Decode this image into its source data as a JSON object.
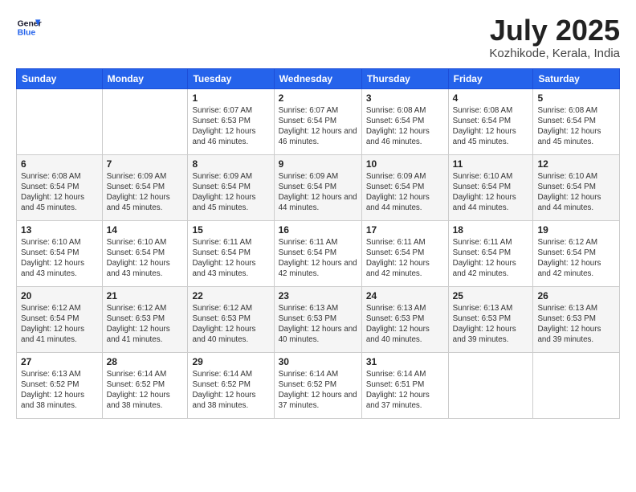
{
  "header": {
    "logo_line1": "General",
    "logo_line2": "Blue",
    "title": "July 2025",
    "subtitle": "Kozhikode, Kerala, India"
  },
  "days_of_week": [
    "Sunday",
    "Monday",
    "Tuesday",
    "Wednesday",
    "Thursday",
    "Friday",
    "Saturday"
  ],
  "weeks": [
    [
      {
        "day": "",
        "info": ""
      },
      {
        "day": "",
        "info": ""
      },
      {
        "day": "1",
        "info": "Sunrise: 6:07 AM\nSunset: 6:53 PM\nDaylight: 12 hours and 46 minutes."
      },
      {
        "day": "2",
        "info": "Sunrise: 6:07 AM\nSunset: 6:54 PM\nDaylight: 12 hours and 46 minutes."
      },
      {
        "day": "3",
        "info": "Sunrise: 6:08 AM\nSunset: 6:54 PM\nDaylight: 12 hours and 46 minutes."
      },
      {
        "day": "4",
        "info": "Sunrise: 6:08 AM\nSunset: 6:54 PM\nDaylight: 12 hours and 45 minutes."
      },
      {
        "day": "5",
        "info": "Sunrise: 6:08 AM\nSunset: 6:54 PM\nDaylight: 12 hours and 45 minutes."
      }
    ],
    [
      {
        "day": "6",
        "info": "Sunrise: 6:08 AM\nSunset: 6:54 PM\nDaylight: 12 hours and 45 minutes."
      },
      {
        "day": "7",
        "info": "Sunrise: 6:09 AM\nSunset: 6:54 PM\nDaylight: 12 hours and 45 minutes."
      },
      {
        "day": "8",
        "info": "Sunrise: 6:09 AM\nSunset: 6:54 PM\nDaylight: 12 hours and 45 minutes."
      },
      {
        "day": "9",
        "info": "Sunrise: 6:09 AM\nSunset: 6:54 PM\nDaylight: 12 hours and 44 minutes."
      },
      {
        "day": "10",
        "info": "Sunrise: 6:09 AM\nSunset: 6:54 PM\nDaylight: 12 hours and 44 minutes."
      },
      {
        "day": "11",
        "info": "Sunrise: 6:10 AM\nSunset: 6:54 PM\nDaylight: 12 hours and 44 minutes."
      },
      {
        "day": "12",
        "info": "Sunrise: 6:10 AM\nSunset: 6:54 PM\nDaylight: 12 hours and 44 minutes."
      }
    ],
    [
      {
        "day": "13",
        "info": "Sunrise: 6:10 AM\nSunset: 6:54 PM\nDaylight: 12 hours and 43 minutes."
      },
      {
        "day": "14",
        "info": "Sunrise: 6:10 AM\nSunset: 6:54 PM\nDaylight: 12 hours and 43 minutes."
      },
      {
        "day": "15",
        "info": "Sunrise: 6:11 AM\nSunset: 6:54 PM\nDaylight: 12 hours and 43 minutes."
      },
      {
        "day": "16",
        "info": "Sunrise: 6:11 AM\nSunset: 6:54 PM\nDaylight: 12 hours and 42 minutes."
      },
      {
        "day": "17",
        "info": "Sunrise: 6:11 AM\nSunset: 6:54 PM\nDaylight: 12 hours and 42 minutes."
      },
      {
        "day": "18",
        "info": "Sunrise: 6:11 AM\nSunset: 6:54 PM\nDaylight: 12 hours and 42 minutes."
      },
      {
        "day": "19",
        "info": "Sunrise: 6:12 AM\nSunset: 6:54 PM\nDaylight: 12 hours and 42 minutes."
      }
    ],
    [
      {
        "day": "20",
        "info": "Sunrise: 6:12 AM\nSunset: 6:54 PM\nDaylight: 12 hours and 41 minutes."
      },
      {
        "day": "21",
        "info": "Sunrise: 6:12 AM\nSunset: 6:53 PM\nDaylight: 12 hours and 41 minutes."
      },
      {
        "day": "22",
        "info": "Sunrise: 6:12 AM\nSunset: 6:53 PM\nDaylight: 12 hours and 40 minutes."
      },
      {
        "day": "23",
        "info": "Sunrise: 6:13 AM\nSunset: 6:53 PM\nDaylight: 12 hours and 40 minutes."
      },
      {
        "day": "24",
        "info": "Sunrise: 6:13 AM\nSunset: 6:53 PM\nDaylight: 12 hours and 40 minutes."
      },
      {
        "day": "25",
        "info": "Sunrise: 6:13 AM\nSunset: 6:53 PM\nDaylight: 12 hours and 39 minutes."
      },
      {
        "day": "26",
        "info": "Sunrise: 6:13 AM\nSunset: 6:53 PM\nDaylight: 12 hours and 39 minutes."
      }
    ],
    [
      {
        "day": "27",
        "info": "Sunrise: 6:13 AM\nSunset: 6:52 PM\nDaylight: 12 hours and 38 minutes."
      },
      {
        "day": "28",
        "info": "Sunrise: 6:14 AM\nSunset: 6:52 PM\nDaylight: 12 hours and 38 minutes."
      },
      {
        "day": "29",
        "info": "Sunrise: 6:14 AM\nSunset: 6:52 PM\nDaylight: 12 hours and 38 minutes."
      },
      {
        "day": "30",
        "info": "Sunrise: 6:14 AM\nSunset: 6:52 PM\nDaylight: 12 hours and 37 minutes."
      },
      {
        "day": "31",
        "info": "Sunrise: 6:14 AM\nSunset: 6:51 PM\nDaylight: 12 hours and 37 minutes."
      },
      {
        "day": "",
        "info": ""
      },
      {
        "day": "",
        "info": ""
      }
    ]
  ]
}
